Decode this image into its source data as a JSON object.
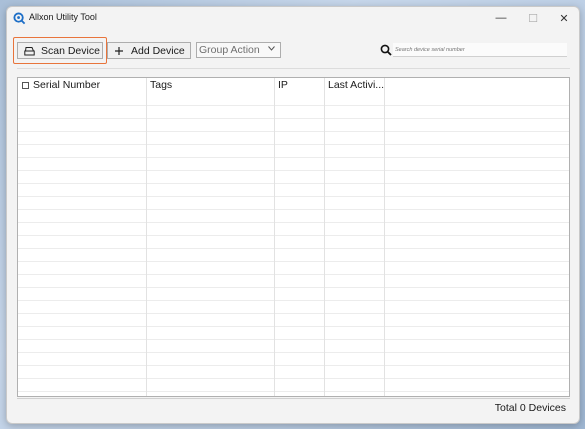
{
  "window": {
    "title": "Allxon Utility Tool",
    "icon": "app-logo-icon",
    "controls": {
      "minimize": "—",
      "maximize": "☐",
      "close": "✕"
    }
  },
  "toolbar": {
    "scan_label": "Scan Device",
    "scan_icon": "scanner-icon",
    "add_label": "Add Device",
    "add_icon": "plus-icon",
    "group_action": "Group Action",
    "search_placeholder": "Search device serial number",
    "highlight_color": "#e8743b"
  },
  "table": {
    "columns": [
      "Serial Number",
      "Tags",
      "IP",
      "Last Activi..."
    ],
    "rows": []
  },
  "status": {
    "total": "Total 0 Devices"
  }
}
